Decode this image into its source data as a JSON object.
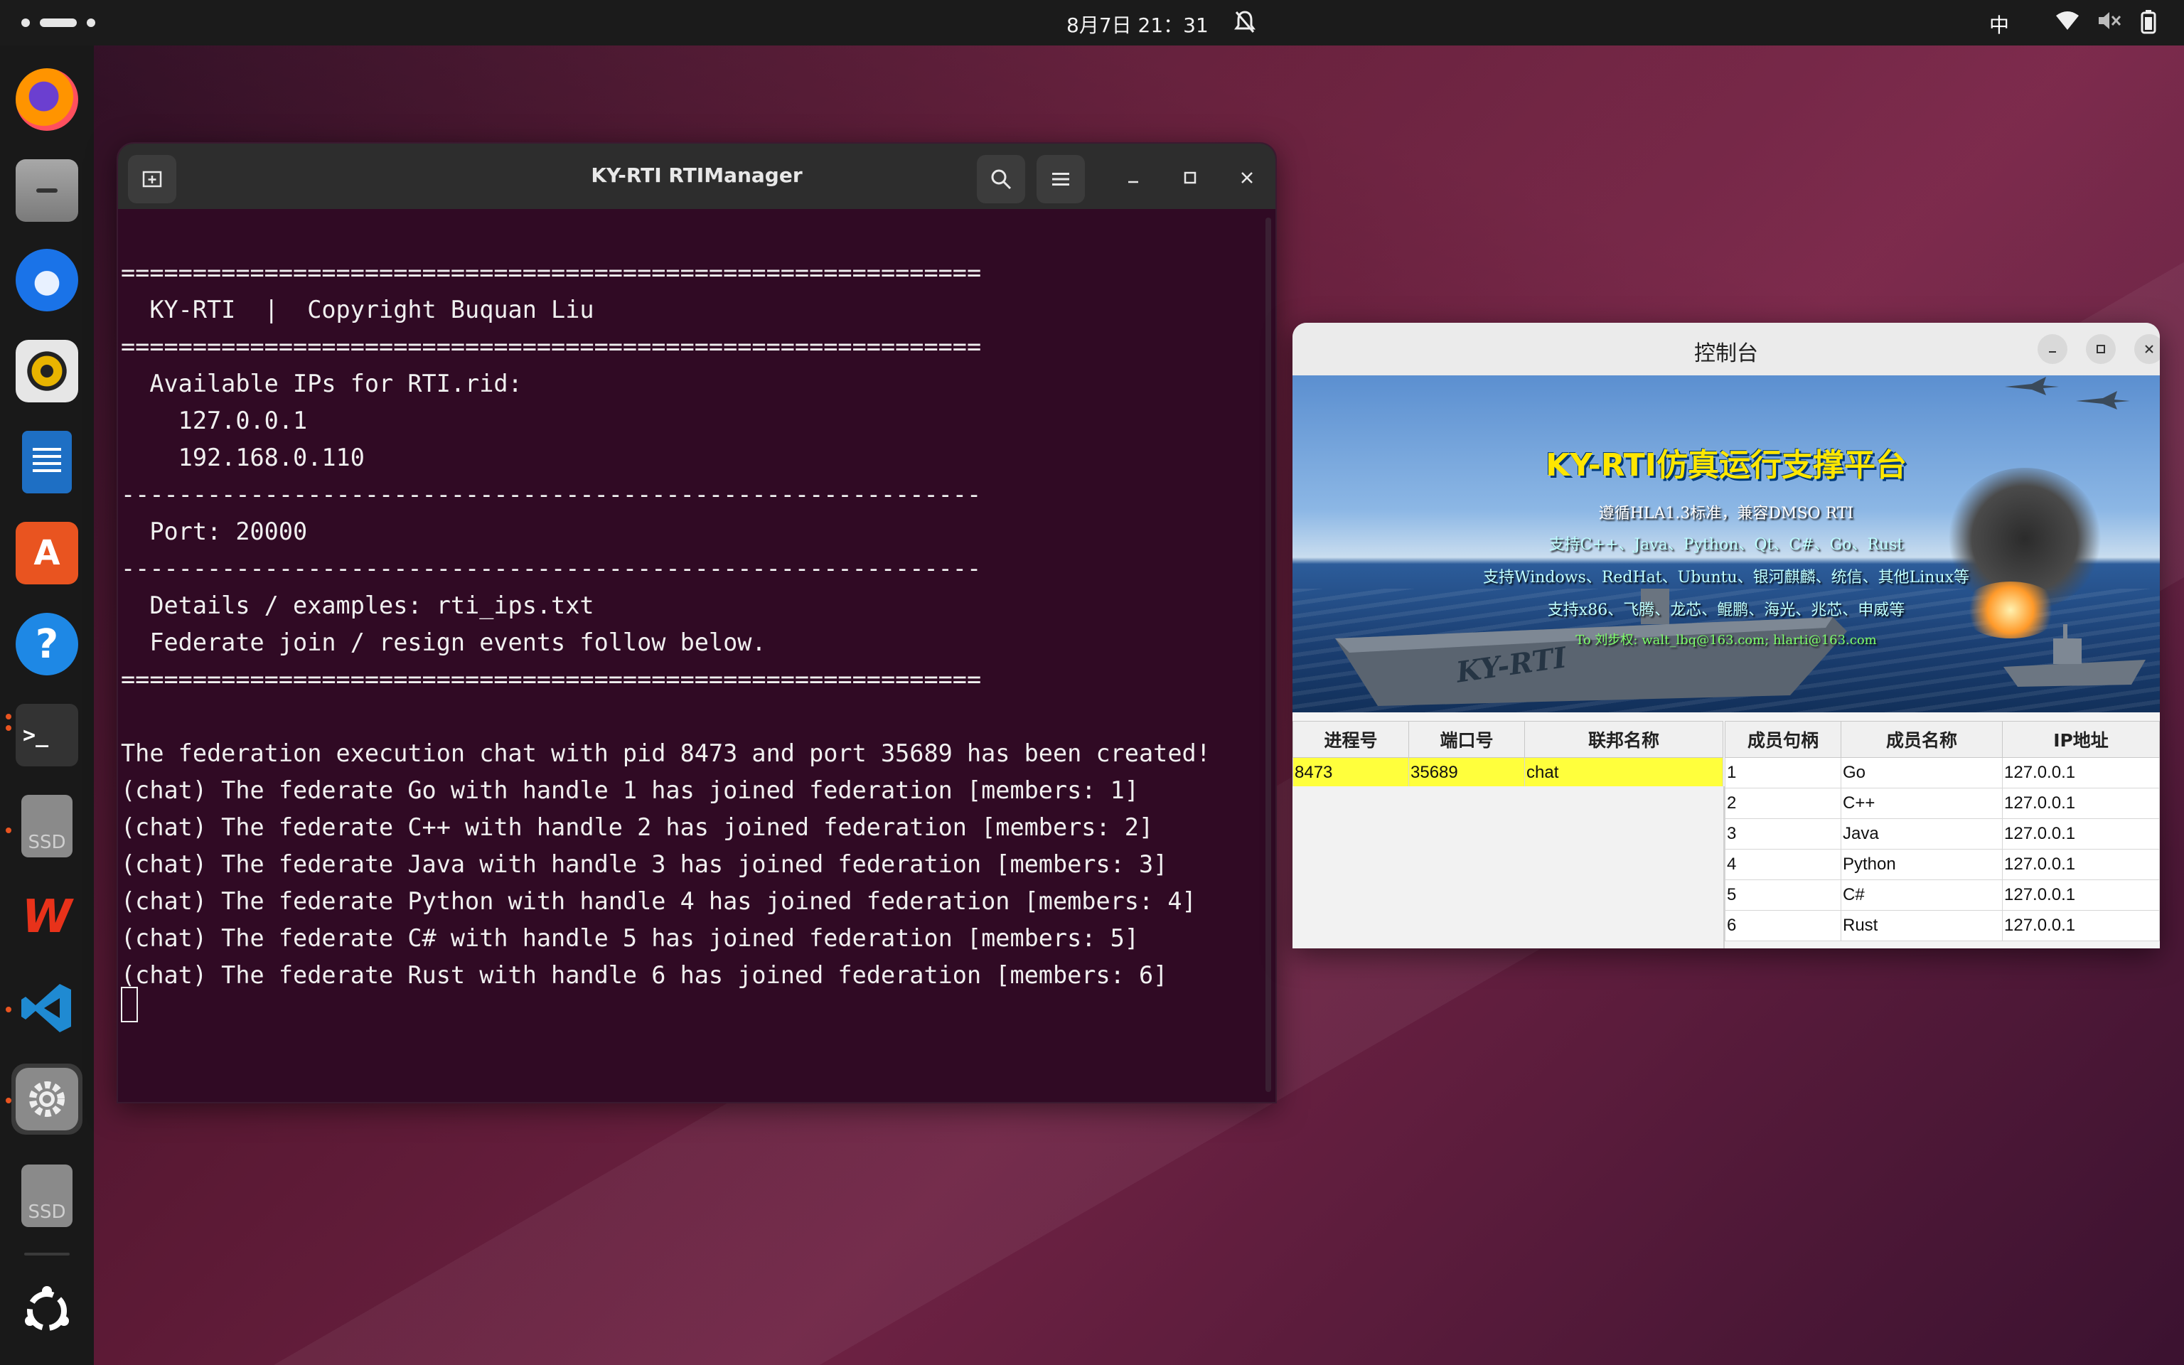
{
  "topbar": {
    "clock": "8月7日 21：31",
    "input_method": "中"
  },
  "dock": {
    "items": [
      {
        "name": "firefox",
        "icon": "firefox-icon",
        "color": "#ff7139"
      },
      {
        "name": "files",
        "icon": "files-icon",
        "color": "#9a9a9a"
      },
      {
        "name": "thunderbird",
        "icon": "thunderbird-icon",
        "color": "#1a73e8"
      },
      {
        "name": "rhythmbox",
        "icon": "speaker-icon",
        "color": "#e8b400"
      },
      {
        "name": "writer",
        "icon": "document-icon",
        "color": "#1e6fc4"
      },
      {
        "name": "app-center",
        "icon": "app-center-icon",
        "color": "#e95420"
      },
      {
        "name": "help",
        "icon": "help-icon",
        "color": "#1e88e5"
      },
      {
        "name": "terminal",
        "icon": "terminal-icon",
        "color": "#333333"
      },
      {
        "name": "ssd",
        "label": "SSD",
        "icon": "drive-icon",
        "color": "#8a8a8a"
      },
      {
        "name": "wps",
        "icon": "wps-icon",
        "color": "#e8321a"
      },
      {
        "name": "vscode",
        "icon": "vscode-icon",
        "color": "#1f8ad2"
      },
      {
        "name": "settings",
        "icon": "gear-icon",
        "color": "#8a8a8a"
      },
      {
        "name": "ssd2",
        "label": "SSD",
        "icon": "drive-icon",
        "color": "#8a8a8a"
      },
      {
        "name": "ubuntu",
        "icon": "ubuntu-icon",
        "color": "#ffffff"
      }
    ]
  },
  "terminal": {
    "title": "KY-RTI RTIManager",
    "lines": [
      "============================================================",
      "  KY-RTI  |  Copyright Buquan Liu",
      "============================================================",
      "  Available IPs for RTI.rid:",
      "    127.0.0.1",
      "    192.168.0.110",
      "------------------------------------------------------------",
      "  Port: 20000",
      "------------------------------------------------------------",
      "  Details / examples: rti_ips.txt",
      "  Federate join / resign events follow below.",
      "============================================================",
      "",
      "The federation execution chat with pid 8473 and port 35689 has been created!",
      "(chat) The federate Go with handle 1 has joined federation [members: 1]",
      "(chat) The federate C++ with handle 2 has joined federation [members: 2]",
      "(chat) The federate Java with handle 3 has joined federation [members: 3]",
      "(chat) The federate Python with handle 4 has joined federation [members: 4]",
      "(chat) The federate C# with handle 5 has joined federation [members: 5]",
      "(chat) The federate Rust with handle 6 has joined federation [members: 6]"
    ]
  },
  "control": {
    "title": "控制台",
    "banner": {
      "title": "KY-RTI仿真运行支撑平台",
      "line1": "遵循HLA1.3标准，兼容DMSO RTI",
      "line2": "支持C++、Java、Python、Qt、C#、Go、Rust",
      "line3": "支持Windows、RedHat、Ubuntu、银河麒麟、统信、其他Linux等",
      "line4": "支持x86、飞腾、龙芯、鲲鹏、海光、兆芯、申威等",
      "line5": "To 刘步权: walt_lbq@163.com; hlarti@163.com",
      "hull": "KY-RTI"
    },
    "process_table": {
      "headers": [
        "进程号",
        "端口号",
        "联邦名称"
      ],
      "rows": [
        [
          "8473",
          "35689",
          "chat"
        ]
      ]
    },
    "member_table": {
      "headers": [
        "成员句柄",
        "成员名称",
        "IP地址"
      ],
      "rows": [
        [
          "1",
          "Go",
          "127.0.0.1"
        ],
        [
          "2",
          "C++",
          "127.0.0.1"
        ],
        [
          "3",
          "Java",
          "127.0.0.1"
        ],
        [
          "4",
          "Python",
          "127.0.0.1"
        ],
        [
          "5",
          "C#",
          "127.0.0.1"
        ],
        [
          "6",
          "Rust",
          "127.0.0.1"
        ]
      ]
    }
  }
}
